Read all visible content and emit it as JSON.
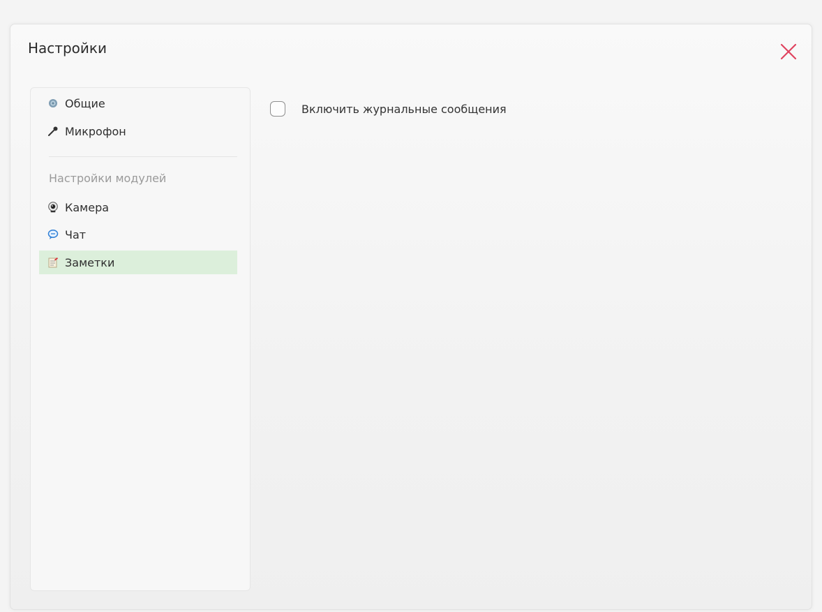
{
  "dialog": {
    "title": "Настройки",
    "close_icon": "close-x-icon",
    "close_color": "#e0435f"
  },
  "sidebar": {
    "general_items": [
      {
        "label": "Общие",
        "icon": "gear-icon"
      },
      {
        "label": "Микрофон",
        "icon": "microphone-icon"
      }
    ],
    "section_title": "Настройки модулей",
    "module_items": [
      {
        "label": "Камера",
        "icon": "webcam-icon"
      },
      {
        "label": "Чат",
        "icon": "chat-bubble-icon"
      },
      {
        "label": "Заметки",
        "icon": "notes-icon",
        "selected": true
      }
    ],
    "selected_color": "#dcefdb"
  },
  "content": {
    "log_checkbox_label": "Включить журнальные сообщения",
    "log_checkbox_checked": false
  }
}
